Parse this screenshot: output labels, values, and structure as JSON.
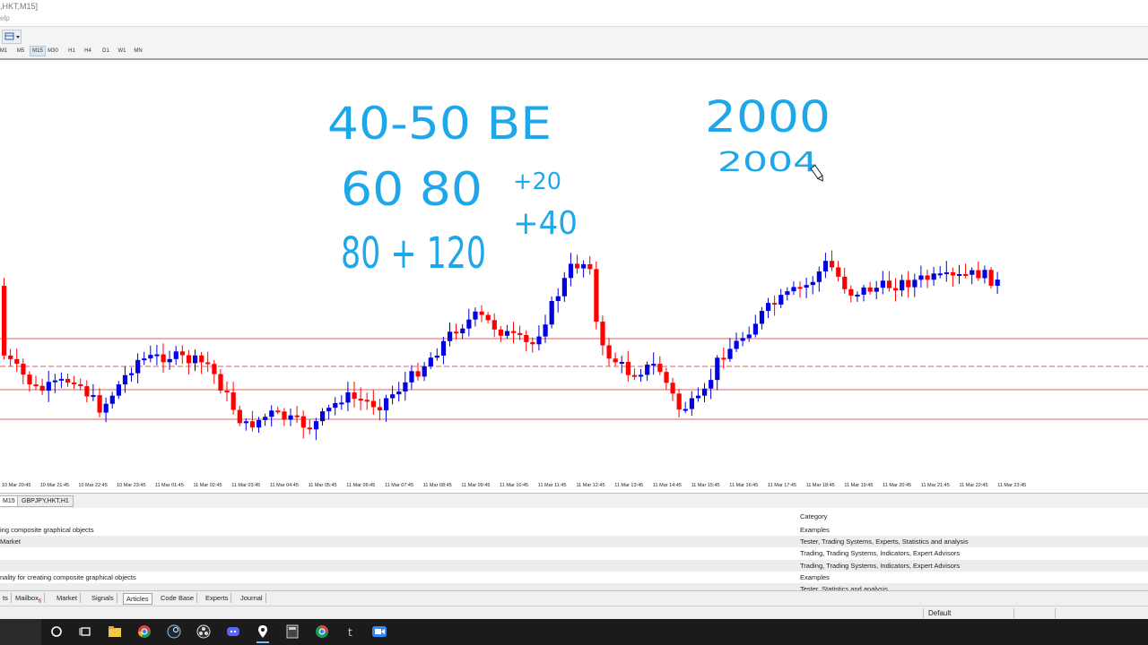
{
  "window": {
    "title": ",HKT,M15]",
    "menu_fragment": "elp"
  },
  "timeframes": [
    "M1",
    "M5",
    "M15",
    "M30",
    "H1",
    "H4",
    "D1",
    "W1",
    "MN"
  ],
  "active_timeframe": "M15",
  "annotations": {
    "line1": "40-50 BE",
    "line2a": "60 80",
    "line2b": "+20",
    "line3a": "80 + 120",
    "line3b": "+40",
    "num1": "2000",
    "num2": "2004"
  },
  "x_axis_labels": [
    "10 Mar 20:45",
    "10 Mar 21:45",
    "10 Mar 22:45",
    "10 Mar 23:45",
    "11 Mar 01:45",
    "11 Mar 02:45",
    "11 Mar 03:45",
    "11 Mar 04:45",
    "11 Mar 05:45",
    "11 Mar 06:45",
    "11 Mar 07:45",
    "11 Mar 08:45",
    "11 Mar 09:45",
    "11 Mar 10:45",
    "11 Mar 11:45",
    "11 Mar 12:45",
    "11 Mar 13:45",
    "11 Mar 14:45",
    "11 Mar 15:45",
    "11 Mar 16:45",
    "11 Mar 17:45",
    "11 Mar 18:45",
    "11 Mar 19:45",
    "11 Mar 20:45",
    "11 Mar 21:45",
    "11 Mar 22:45",
    "11 Mar 23:45"
  ],
  "chart_tabs": [
    "M15",
    "GBPJPY,HKT,H1"
  ],
  "terminal": {
    "category_header": "Category",
    "rows": [
      {
        "title": "ing composite graphical objects",
        "category": "Examples"
      },
      {
        "title": "Market",
        "category": "Tester, Trading Systems, Experts, Statistics and analysis"
      },
      {
        "title": "",
        "category": "Trading, Trading Systems, Indicators, Expert Advisors"
      },
      {
        "title": "",
        "category": "Trading, Trading Systems, Indicators, Expert Advisors"
      },
      {
        "title": "nality for creating composite graphical objects",
        "category": "Examples"
      },
      {
        "title": "",
        "category": "Tester, Statistics and analysis"
      }
    ]
  },
  "terminal_tabs": [
    "ts",
    "Mailbox",
    "Market",
    "Signals",
    "Articles",
    "Code Base",
    "Experts",
    "Journal"
  ],
  "mailbox_badge": "6",
  "active_terminal_tab": "Articles",
  "status": {
    "profile": "Default"
  },
  "colors": {
    "bull": "#0000e0",
    "bear": "#ff0000",
    "ink": "#1ea8ea",
    "hline": "#e06060"
  },
  "taskbar_icons": [
    "search-icon",
    "task-view-icon",
    "file-explorer-icon",
    "chrome-icon",
    "steam-icon",
    "obs-icon",
    "discord-icon",
    "maps-icon",
    "calculator-icon",
    "chrome-alt-icon",
    "tradingview-icon",
    "zoom-icon"
  ]
}
